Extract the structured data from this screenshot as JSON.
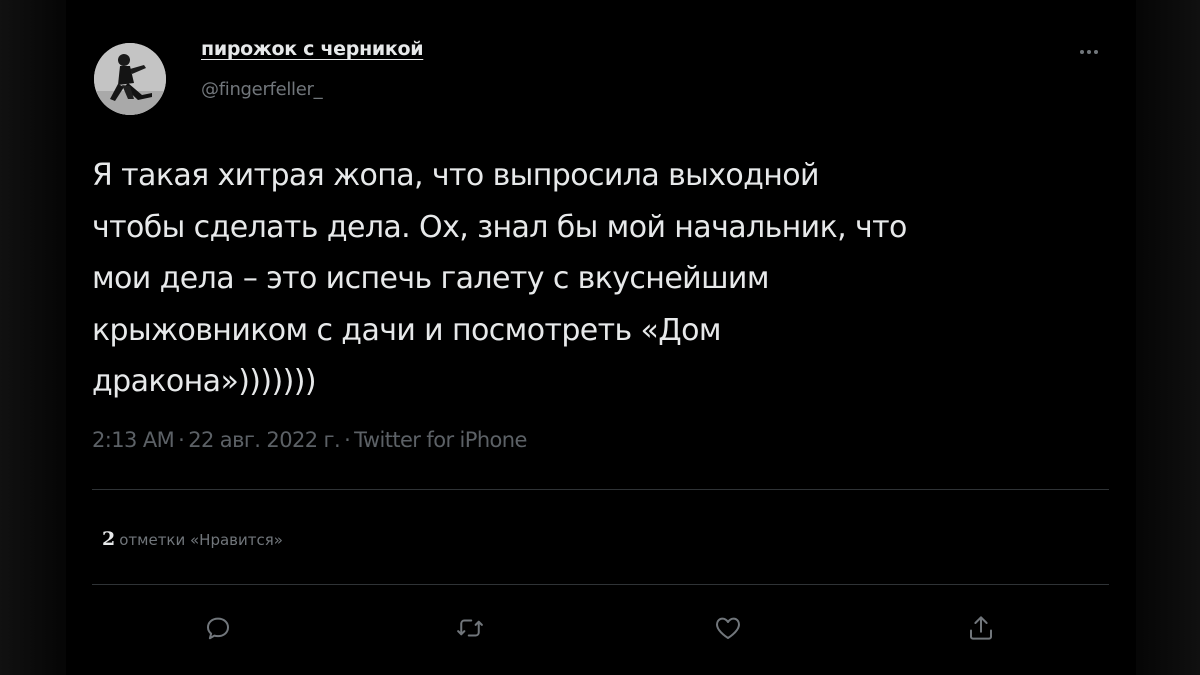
{
  "author": {
    "name": "пирожок с черникой",
    "handle": "@fingerfeller_"
  },
  "tweet": {
    "lines": [
      "Я такая хитрая жопа, что выпросила выходной",
      "чтобы сделать дела. Ох, знал бы мой начальник, что",
      "мои дела – это испечь галету с вкуснейшим",
      "крыжовником с дачи и посмотреть «Дом",
      "дракона»)))))))"
    ],
    "time": "2:13 AM",
    "date": "22 авг. 2022 г.",
    "source": "Twitter for iPhone",
    "separator": "·"
  },
  "stats": {
    "likes_count": "2",
    "likes_label": "отметки «Нравится»"
  },
  "actions": {
    "reply_icon": "reply-icon",
    "retweet_icon": "retweet-icon",
    "like_icon": "heart-icon",
    "share_icon": "share-icon"
  },
  "colors": {
    "background": "#000000",
    "text_primary": "#e7e9ea",
    "text_secondary": "#71767b",
    "divider": "#2f3336"
  }
}
